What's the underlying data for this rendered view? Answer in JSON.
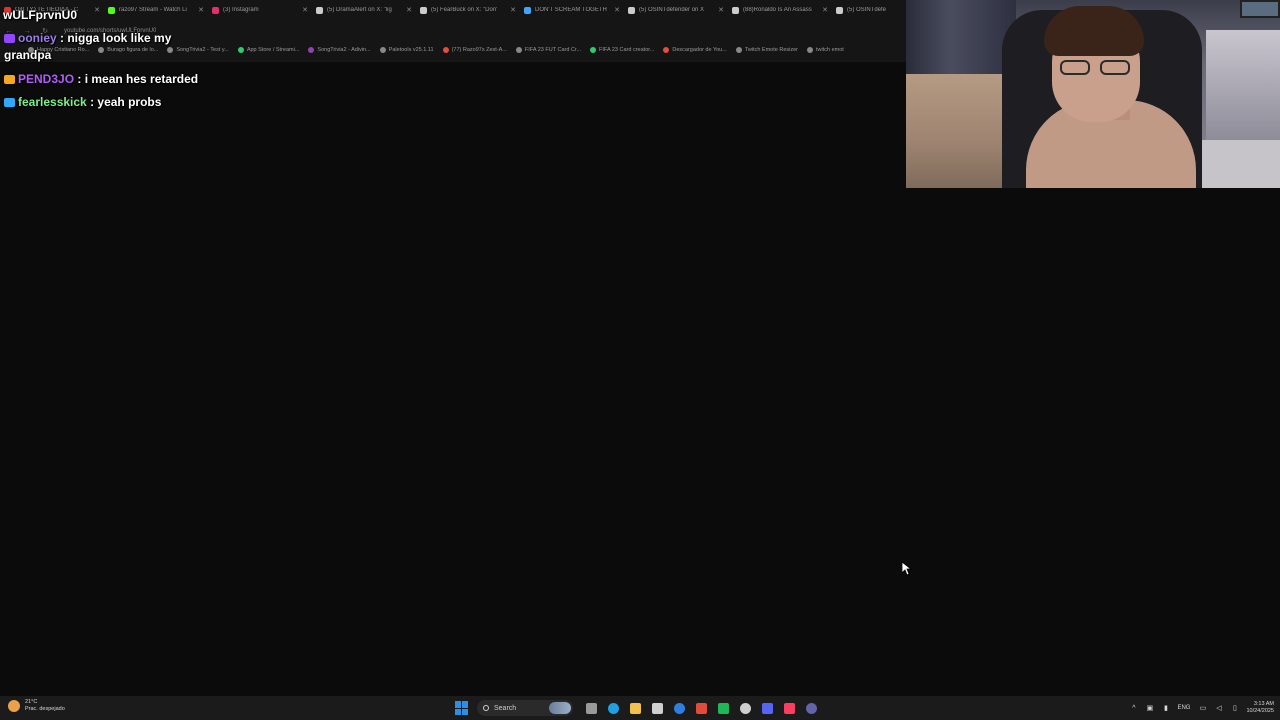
{
  "browser": {
    "tabs": [
      {
        "label": "Ωιβ ΤΥΣΤΕ ΠΕΩΙΔΑ - C",
        "color": "#d33"
      },
      {
        "label": "razo97 Stream - Watch Li",
        "color": "#53fc18"
      },
      {
        "label": "(3) Instagram",
        "color": "#e1306c"
      },
      {
        "label": "(5) DramaAlert on X: \"lig",
        "color": "#cccccc"
      },
      {
        "label": "(5) FearBuck on X: \"Don'",
        "color": "#cccccc"
      },
      {
        "label": "DON'T SCREAM TOGETH",
        "color": "#3ea6ff"
      },
      {
        "label": "(5) OSINTdefender on X",
        "color": "#cccccc"
      },
      {
        "label": "(88)Ronaldo Is An Assass",
        "color": "#cccccc"
      },
      {
        "label": "(5) OSINTdefe",
        "color": "#cccccc"
      }
    ],
    "address_url": "youtube.com/shorts/uwULFprvnU0",
    "bookmarks": [
      {
        "label": "Happy Cristiano Ro...",
        "color": "#888888"
      },
      {
        "label": "Burago figura de lo...",
        "color": "#888888"
      },
      {
        "label": "SongTrivia2 - Test y...",
        "color": "#888888"
      },
      {
        "label": "App Store / Streami...",
        "color": "#2ecc71"
      },
      {
        "label": "SongTrivia2 - Adivin...",
        "color": "#8e44ad"
      },
      {
        "label": "Paletools v25.1.11",
        "color": "#888888"
      },
      {
        "label": "(77) Razo97s Zest-A...",
        "color": "#e74c3c"
      },
      {
        "label": "FIFA 23 FUT Card Cr...",
        "color": "#888888"
      },
      {
        "label": "FIFA 23 Card creator...",
        "color": "#2ecc71"
      },
      {
        "label": "Descargador de You...",
        "color": "#e74c3c"
      },
      {
        "label": "Twitch Emote Resizer",
        "color": "#888888"
      },
      {
        "label": "twitch emot",
        "color": "#888888"
      }
    ]
  },
  "overlay": {
    "url_text": "wULFprvnU0"
  },
  "chat": {
    "messages": [
      {
        "username": "ooniey",
        "user_color": "#9b7ee8",
        "badge_color": "#9146ff",
        "text": " : nigga look like my grandpa"
      },
      {
        "username": "PEND3JO",
        "user_color": "#b45cff",
        "badge_color": "#f5a623",
        "text": " : i mean hes retarded"
      },
      {
        "username": "fearlesskick",
        "user_color": "#7cf08a",
        "badge_color": "#2fa6ff",
        "text": " : yeah probs"
      }
    ]
  },
  "taskbar": {
    "weather_temp": "21°C",
    "weather_desc": "Prac. despejado",
    "search_label": "Search",
    "language": "ENG",
    "time": "3:13 AM",
    "date": "10/24/2025",
    "apps": [
      {
        "name": "task-view-icon",
        "color": "#9a9a9a"
      },
      {
        "name": "edge-icon",
        "color": "#1fa0e0"
      },
      {
        "name": "file-explorer-icon",
        "color": "#f2c14e"
      },
      {
        "name": "store-icon",
        "color": "#d0d0d0"
      },
      {
        "name": "mail-icon",
        "color": "#2f7fe0"
      },
      {
        "name": "chrome-icon",
        "color": "#e04b3a"
      },
      {
        "name": "spotify-icon",
        "color": "#1db954"
      },
      {
        "name": "obs-icon",
        "color": "#cfcfcf"
      },
      {
        "name": "discord-icon",
        "color": "#5865f2"
      },
      {
        "name": "music-icon",
        "color": "#fa3e5f"
      },
      {
        "name": "teams-icon",
        "color": "#6264a7"
      }
    ]
  }
}
